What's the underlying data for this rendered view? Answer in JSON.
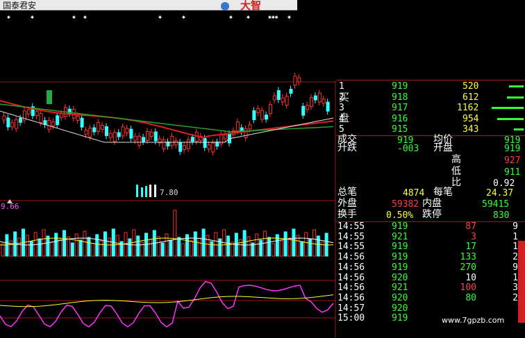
{
  "window": {
    "title": "国泰君安",
    "brand_text": "大智"
  },
  "chart_labels": {
    "volume_peak": "7.80",
    "indicator_value": "9.66"
  },
  "order_book": {
    "buy_label_1": "买",
    "buy_label_2": "盘",
    "rows": [
      {
        "level": "1",
        "price": "919",
        "volume": "520"
      },
      {
        "level": "2",
        "price": "918",
        "volume": "612"
      },
      {
        "level": "3",
        "price": "917",
        "volume": "1162"
      },
      {
        "level": "4",
        "price": "916",
        "volume": "954"
      },
      {
        "level": "5",
        "price": "915",
        "volume": "343"
      }
    ],
    "bar_fractions": [
      0.45,
      0.53,
      1.0,
      0.82,
      0.3
    ]
  },
  "quote": {
    "turnover_label": "成交",
    "turnover_value": "919",
    "avg_label": "均价",
    "avg_value": "919",
    "change_label": "升跌",
    "change_value": "-003",
    "open_label": "开盘",
    "open_value": "919",
    "high_label": "高",
    "high_value": "927",
    "low_label": "低",
    "low_value": "911",
    "ratio_label": "比",
    "ratio_value": "0.92",
    "total_trades_label": "总笔",
    "total_trades_value": "4874",
    "per_trade_label": "每笔",
    "per_trade_value": "24.37",
    "outer_label": "外盘",
    "outer_value": "59382",
    "inner_label": "内盘",
    "inner_value": "59415",
    "turnover_rate_label": "换手",
    "turnover_rate_value": "0.50%",
    "limit_down_label": "跌停",
    "limit_down_value": "830"
  },
  "ticks": [
    {
      "time": "14:55",
      "price": "919",
      "vol": "87",
      "extra": "9"
    },
    {
      "time": "14:55",
      "price": "921",
      "vol": "3",
      "extra": "1"
    },
    {
      "time": "14:55",
      "price": "919",
      "vol": "17",
      "extra": "1"
    },
    {
      "time": "14:56",
      "price": "919",
      "vol": "133",
      "extra": "2"
    },
    {
      "time": "14:56",
      "price": "919",
      "vol": "270",
      "extra": "9"
    },
    {
      "time": "14:56",
      "price": "920",
      "vol": "10",
      "extra": "1"
    },
    {
      "time": "14:56",
      "price": "921",
      "vol": "100",
      "extra": "3"
    },
    {
      "time": "14:56",
      "price": "920",
      "vol": "80",
      "extra": "2"
    },
    {
      "time": "14:57",
      "price": "920",
      "vol": "",
      "extra": ""
    },
    {
      "time": "15:00",
      "price": "919",
      "vol": "",
      "extra": ""
    }
  ],
  "tick_colors": {
    "price": "#33ff33",
    "vol_up": "#ff4040",
    "vol_neutral": "#ffffff"
  },
  "watermark": "www.7gpzb.com",
  "colors": {
    "up": "#ff3030",
    "down": "#33ffff",
    "ma_red": "#e02020",
    "ma_green": "#2aa02a",
    "ma_white": "#e0e0e0",
    "grid": "#a01818"
  }
}
